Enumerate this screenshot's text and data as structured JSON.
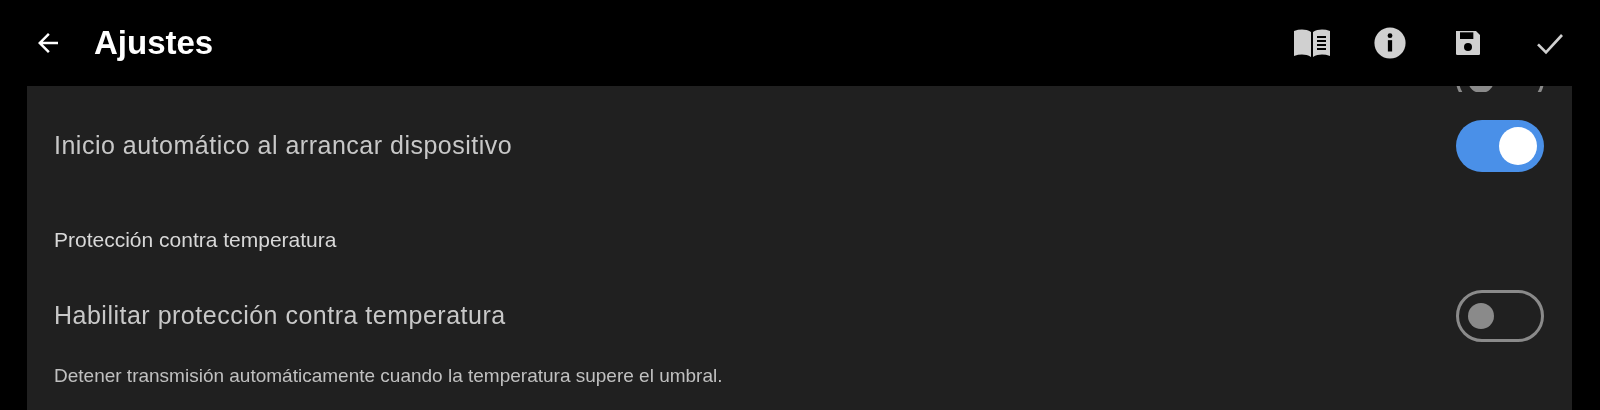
{
  "app_bar": {
    "title": "Ajustes"
  },
  "items": [
    {
      "kind": "clipped_toggle",
      "on": false
    },
    {
      "kind": "toggle",
      "label": "Inicio automático al arrancar dispositivo",
      "on": true
    },
    {
      "kind": "section",
      "label": "Protección contra temperatura"
    },
    {
      "kind": "toggle",
      "label": "Habilitar protección contra temperatura",
      "on": false,
      "description": "Detener transmisión automáticamente cuando la temperatura supere el umbral."
    }
  ]
}
